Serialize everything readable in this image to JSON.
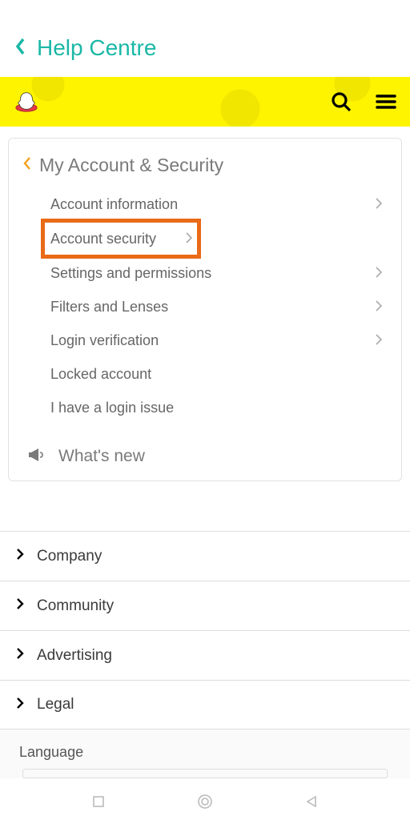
{
  "header": {
    "title": "Help Centre"
  },
  "card": {
    "title": "My Account & Security",
    "items": [
      {
        "label": "Account information",
        "hasChevron": true,
        "highlight": false
      },
      {
        "label": "Account security",
        "hasChevron": true,
        "highlight": true
      },
      {
        "label": "Settings and permissions",
        "hasChevron": true,
        "highlight": false
      },
      {
        "label": "Filters and Lenses",
        "hasChevron": true,
        "highlight": false
      },
      {
        "label": "Login verification",
        "hasChevron": true,
        "highlight": false
      },
      {
        "label": "Locked account",
        "hasChevron": false,
        "highlight": false
      },
      {
        "label": "I have a login issue",
        "hasChevron": false,
        "highlight": false
      }
    ],
    "whatsNew": "What's new"
  },
  "footer": {
    "items": [
      {
        "label": "Company"
      },
      {
        "label": "Community"
      },
      {
        "label": "Advertising"
      },
      {
        "label": "Legal"
      }
    ],
    "language_label": "Language"
  }
}
